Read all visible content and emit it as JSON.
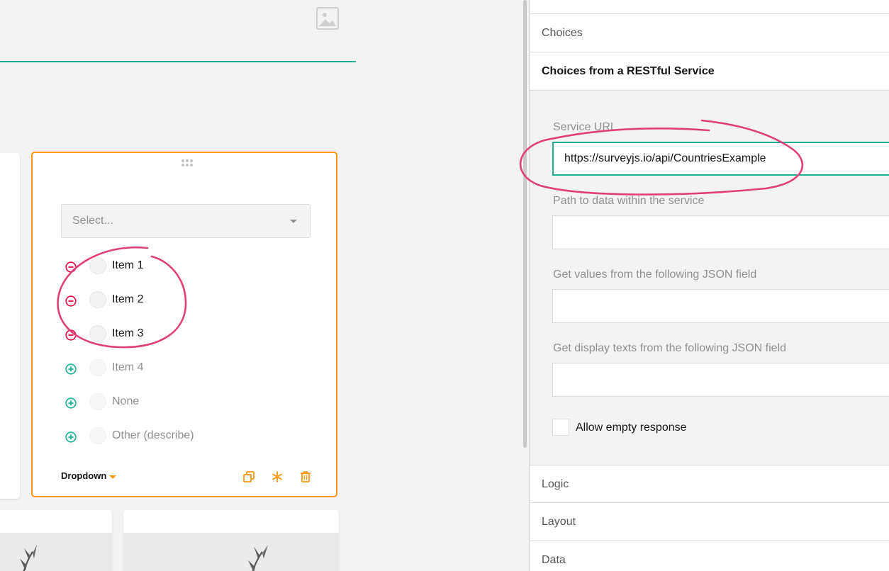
{
  "question": {
    "select_placeholder": "Select...",
    "choices": [
      {
        "label": "Item 1",
        "action": "remove"
      },
      {
        "label": "Item 2",
        "action": "remove"
      },
      {
        "label": "Item 3",
        "action": "remove"
      },
      {
        "label": "Item 4",
        "action": "add"
      },
      {
        "label": "None",
        "action": "add"
      },
      {
        "label": "Other (describe)",
        "action": "add"
      }
    ],
    "type_label": "Dropdown"
  },
  "panel": {
    "sections": {
      "choices": "Choices",
      "choices_rest": "Choices from a RESTful Service",
      "logic": "Logic",
      "layout": "Layout",
      "data": "Data"
    },
    "fields": {
      "service_url_label": "Service URL",
      "service_url_value": "https://surveyjs.io/api/CountriesExample",
      "path_label": "Path to data within the service",
      "path_value": "",
      "values_label": "Get values from the following JSON field",
      "values_value": "",
      "texts_label": "Get display texts from the following JSON field",
      "texts_value": "",
      "allow_empty_label": "Allow empty response",
      "allow_empty_checked": false
    }
  },
  "colors": {
    "accent_teal": "#19b394",
    "selection_orange": "#ff9814",
    "remove_red": "#e50a3e",
    "annotation_pink": "#e0407a"
  },
  "icons": [
    "image-icon",
    "drag-handle-icon",
    "chevron-down-icon",
    "remove-circle-icon",
    "add-circle-icon",
    "copy-icon",
    "required-asterisk-icon",
    "trash-icon"
  ]
}
